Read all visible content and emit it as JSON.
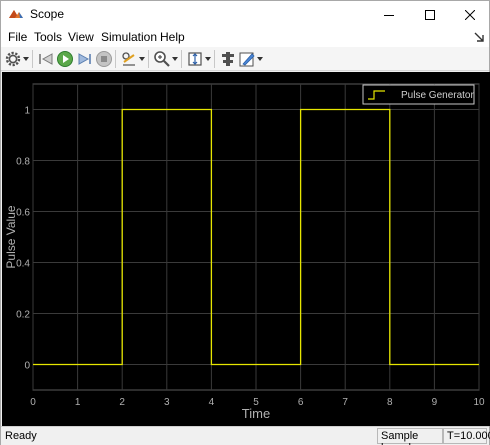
{
  "window": {
    "title": "Scope",
    "icon": "matlab-scope-icon"
  },
  "menu": {
    "file": "File",
    "tools": "Tools",
    "view": "View",
    "simulation": "Simulation",
    "help": "Help"
  },
  "toolbar": {
    "icons": [
      "gear-icon",
      "step-back-icon",
      "run-icon",
      "step-forward-icon",
      "stop-icon",
      "highlight-icon",
      "zoom-icon",
      "fit-icon",
      "cursor-icon",
      "edit-icon"
    ]
  },
  "chart_data": {
    "type": "line",
    "title": "",
    "xlabel": "Time",
    "ylabel": "Pulse Value",
    "xlim": [
      0,
      10
    ],
    "ylim": [
      -0.1,
      1.1
    ],
    "x_ticks": [
      0,
      1,
      2,
      3,
      4,
      5,
      6,
      7,
      8,
      9,
      10
    ],
    "y_ticks": [
      0,
      0.2,
      0.4,
      0.6,
      0.8,
      1
    ],
    "y_tick_labels": [
      "0",
      "0.2",
      "0.4",
      "0.6",
      "0.8",
      "1"
    ],
    "grid": true,
    "legend_position": "top-right",
    "background": "#000000",
    "series": [
      {
        "name": "Pulse Generator",
        "color": "#e6e600",
        "x": [
          0,
          2,
          2,
          4,
          4,
          6,
          6,
          8,
          8,
          10
        ],
        "y": [
          0,
          0,
          1,
          1,
          0,
          0,
          1,
          1,
          0,
          0
        ]
      }
    ]
  },
  "status": {
    "state": "Ready",
    "sample_mode": "Sample based",
    "time": "T=10.000"
  }
}
